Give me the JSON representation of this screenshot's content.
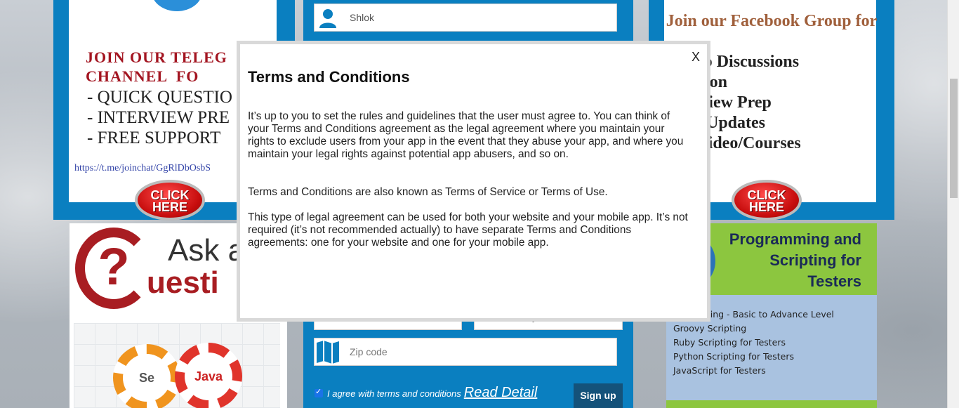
{
  "telegram_banner": {
    "title_lines": "JOIN OUR TELEG\nCHANNEL  FO",
    "items": [
      "- QUICK QUESTIO",
      "- INTERVIEW PRE",
      "- FREE SUPPORT"
    ],
    "link": "https://t.me/joinchat/GgRlDbOsbS",
    "click_label": "CLICK HERE"
  },
  "facebook_banner": {
    "title": "Join our Facebook Group for",
    "items": [
      "oup Discussions",
      "estion",
      "erview Prep",
      "ck Updates",
      "e Video/Courses"
    ],
    "click_label": "CLICK HERE"
  },
  "signup_form": {
    "name_value": "Shlok",
    "zip_placeholder": "Zip code",
    "partial_field_text": "y",
    "agree_text": "I agree with terms and conditions",
    "read_detail_link": "Read Detail",
    "signup_button": "Sign up"
  },
  "ask_card": {
    "line1": "Ask a",
    "line2": "uesti",
    "gear_left": "Se",
    "gear_right": "Java"
  },
  "programming_card": {
    "title": "Programming and Scripting for Testers",
    "items": [
      "ogramming - Basic to Advance Level",
      "Groovy Scripting",
      "Ruby Scripting for Testers",
      "Python Scripting for Testers",
      "JavaScript for Testers"
    ]
  },
  "modal": {
    "close_label": "X",
    "title": "Terms and Conditions",
    "paragraphs": [
      "It’s up to you to set the rules and guidelines that the user must agree to. You can think of your Terms and Conditions agreement as the legal agreement where you maintain your rights to exclude users from your app in the event that they abuse your app, and where you maintain your legal rights against potential app abusers, and so on.",
      "Terms and Conditions are also known as Terms of Service or Terms of Use.",
      "This type of legal agreement can be used for both your website and your mobile app. It’s not required (it’s not recommended actually) to have separate Terms and Conditions agreements: one for your website and one for your mobile app."
    ]
  }
}
